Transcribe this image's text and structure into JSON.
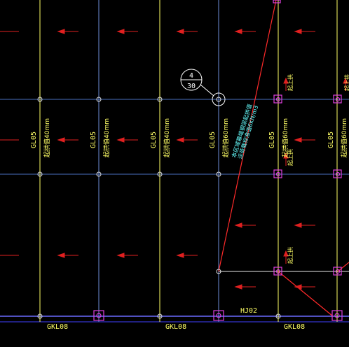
{
  "colors": {
    "background": "#000000",
    "grid_blue": "#4a6fc0",
    "beam_yellow": "#ffff66",
    "axis_cyan": "#59d9e8",
    "rebar_red": "#e02020",
    "load_red": "#ff2a2a",
    "marker_magenta": "#e040e0",
    "bottom_beam_blue": "#4040ff",
    "text_white": "#ffffff",
    "text_yellow": "#ffff66",
    "text_cyan": "#66ffff"
  },
  "beam_labels": {
    "gl05_a": "GL05",
    "gl05_b": "GL05",
    "gl05_c": "GL05",
    "gl05_d": "GL05",
    "gl05_e": "GL05",
    "gl05_f": "GL05",
    "gkl08_a": "GKL08",
    "gkl08_b": "GKL08",
    "gkl08_c": "GKL08",
    "hj02": "HJ02"
  },
  "camber_labels": {
    "c1": "起拱值40mm",
    "c2": "起拱值40mm",
    "c3": "起拱值40mm",
    "c4": "起拱值60mm",
    "c5": "起拱值60mm",
    "c6": "起拱值60mm"
  },
  "lift_labels": {
    "l1": "起上拱",
    "l2": "起上拱",
    "l3": "起上拱",
    "l4": "起上拱"
  },
  "detail_callout": {
    "number": "4",
    "sheet": "30"
  },
  "diagonal_note": {
    "line1": "本区域幕墙钢梁起拱值",
    "line2": "活荷载标准值6KN/m3"
  }
}
